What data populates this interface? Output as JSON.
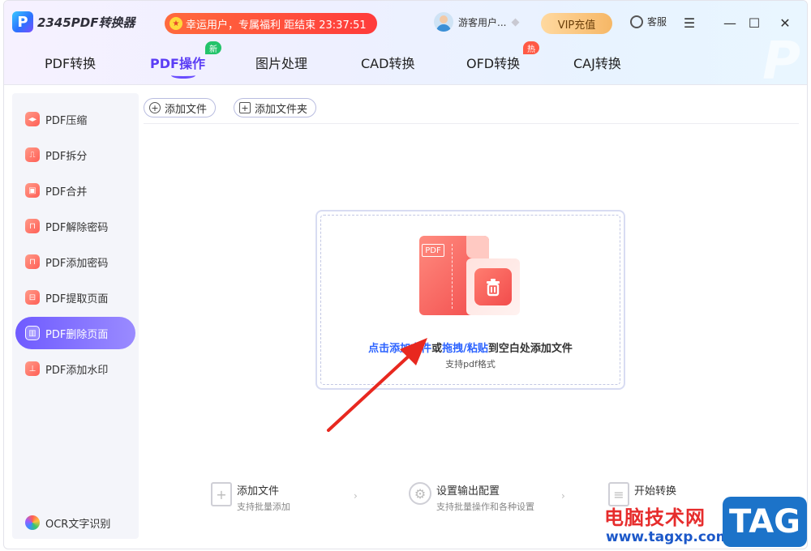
{
  "header": {
    "logo_text": "2345PDF转换器",
    "promo_text": "幸运用户，专属福利 距结束 23:37:51",
    "user_name": "游客用户...",
    "vip_label": "VIP充值",
    "service_label": "客服"
  },
  "tabs": [
    {
      "label": "PDF转换"
    },
    {
      "label": "PDF操作",
      "badge": "新"
    },
    {
      "label": "图片处理"
    },
    {
      "label": "CAD转换"
    },
    {
      "label": "OFD转换",
      "badge": "热"
    },
    {
      "label": "CAJ转换"
    }
  ],
  "sidebar": {
    "items": [
      {
        "label": "PDF压缩"
      },
      {
        "label": "PDF拆分"
      },
      {
        "label": "PDF合并"
      },
      {
        "label": "PDF解除密码"
      },
      {
        "label": "PDF添加密码"
      },
      {
        "label": "PDF提取页面"
      },
      {
        "label": "PDF删除页面"
      },
      {
        "label": "PDF添加水印"
      }
    ],
    "ocr_label": "OCR文字识别"
  },
  "toolbar": {
    "add_file": "添加文件",
    "add_folder": "添加文件夹"
  },
  "dropzone": {
    "pdf_tag": "PDF",
    "link_add": "点击添加文件",
    "or": "或",
    "link_drag": "拖拽/粘贴",
    "suffix": "到空白处添加文件",
    "sub": "支持pdf格式"
  },
  "steps": [
    {
      "title": "添加文件",
      "sub": "支持批量添加"
    },
    {
      "title": "设置输出配置",
      "sub": "支持批量操作和各种设置"
    },
    {
      "title": "开始转换",
      "sub": ""
    }
  ],
  "watermark": {
    "cn": "电脑技术网",
    "url": "www.tagxp.com",
    "tag": "TAG"
  },
  "colors": {
    "accent": "#6a4cff",
    "link": "#2c63ff",
    "promo": "#ff3b3b",
    "pdf_red": "#f24c4c"
  }
}
